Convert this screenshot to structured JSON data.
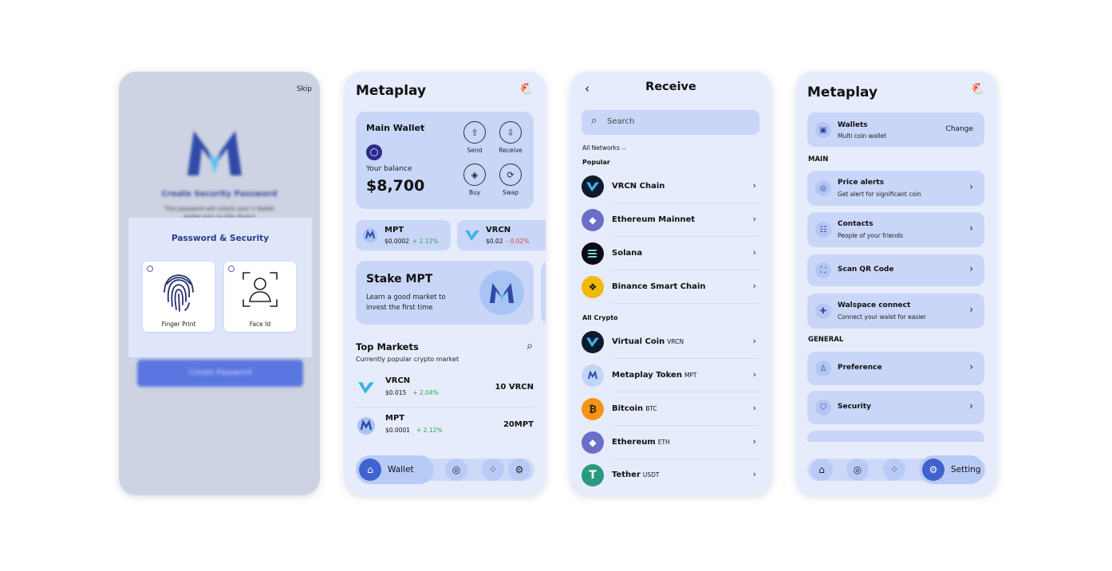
{
  "screen1": {
    "skip": "Skip",
    "title": "Create Security Password",
    "subtitle_line1": "This password will unlock your V Wallet",
    "subtitle_line2": "wallet only on this device",
    "sheet_title": "Password & Security",
    "option_finger": "Finger Print",
    "option_face": "Face Id",
    "create_button": "Create Password"
  },
  "screen2": {
    "app_title": "Metaplay",
    "wallet_name": "Main Wallet",
    "balance_label": "Your balance",
    "balance": "$8,700",
    "actions": [
      "Send",
      "Receive",
      "Buy",
      "Swap"
    ],
    "tokens": [
      {
        "name": "MPT",
        "price": "$0.0002",
        "change": "+ 2.12%"
      },
      {
        "name": "VRCN",
        "price": "$0.02",
        "change": "- 0.02%"
      }
    ],
    "stake_title": "Stake MPT",
    "stake_desc": "Learn a good market to invest the first time",
    "top_markets_title": "Top Markets",
    "top_markets_sub": "Currently popular crypto market",
    "markets": [
      {
        "name": "VRCN",
        "price": "$0.015",
        "change": "+ 2.04%",
        "amount": "10 VRCN"
      },
      {
        "name": "MPT",
        "price": "$0.0001",
        "change": "+ 2.12%",
        "amount": "20MPT"
      }
    ],
    "nav_active": "Wallet"
  },
  "screen3": {
    "title": "Receive",
    "search_placeholder": "Search",
    "networks": "All Networks",
    "popular_label": "Popular",
    "popular": [
      {
        "name": "VRCN Chain",
        "symbol": ""
      },
      {
        "name": "Ethereum Mainnet",
        "symbol": ""
      },
      {
        "name": "Solana",
        "symbol": ""
      },
      {
        "name": "Binance Smart Chain",
        "symbol": ""
      }
    ],
    "all_label": "All Crypto",
    "all": [
      {
        "name": "Virtual Coin",
        "symbol": "VRCN"
      },
      {
        "name": "Metaplay Token",
        "symbol": "MPT"
      },
      {
        "name": "Bitcoin",
        "symbol": "BTC"
      },
      {
        "name": "Ethereum",
        "symbol": "ETH"
      },
      {
        "name": "Tether",
        "symbol": "USDT"
      }
    ]
  },
  "screen4": {
    "app_title": "Metaplay",
    "wallets_title": "Wallets",
    "wallets_sub": "Multi coin wallet",
    "change": "Change",
    "main_label": "MAIN",
    "main_items": [
      {
        "title": "Price alerts",
        "sub": "Get alert for significant coin"
      },
      {
        "title": "Contacts",
        "sub": "People of your friends"
      },
      {
        "title": "Scan QR Code",
        "sub": ""
      },
      {
        "title": "Walspace connect",
        "sub": "Connect your walet for easier"
      }
    ],
    "general_label": "GENERAL",
    "general_items": [
      {
        "title": "Preference"
      },
      {
        "title": "Security"
      }
    ],
    "nav_active": "Setting"
  },
  "colors": {
    "accent": "#3f62cf",
    "card": "#c9d6f8",
    "bg": "#e6ecfb",
    "up": "#27a845",
    "down": "#e23b3b"
  }
}
